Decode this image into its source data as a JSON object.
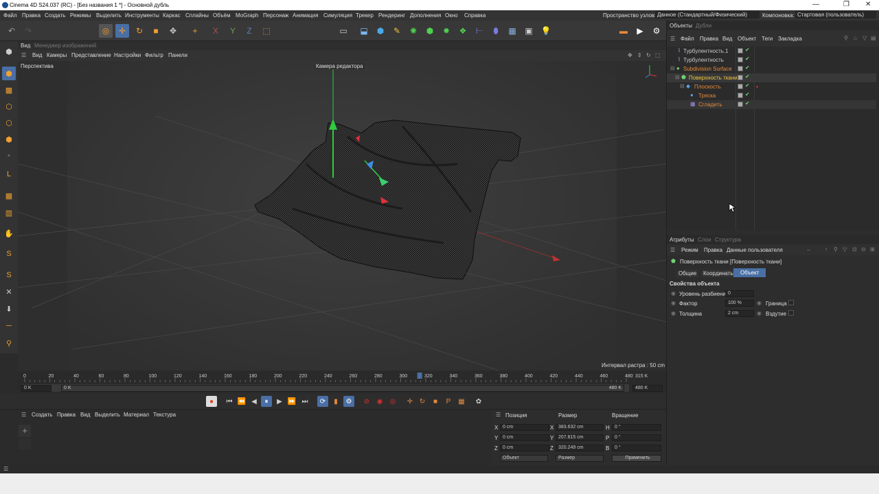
{
  "window": {
    "title": "Cinema 4D S24.037 (RC) - [Без названия 1 *] - Основной дубль",
    "min": "—",
    "max": "❐",
    "close": "✕"
  },
  "menu": [
    "Файл",
    "Правка",
    "Создать",
    "Режимы",
    "Выделить",
    "Инструменты",
    "Каркас",
    "Сплайны",
    "Объём",
    "MoGraph",
    "Персонаж",
    "Анимация",
    "Симуляция",
    "Трекер",
    "Рендеринг",
    "Дополнения",
    "Окно",
    "Справка"
  ],
  "node_space": {
    "label": "Пространство узлов:",
    "value": "Данное (Стандартный/Физический)"
  },
  "layout": {
    "label": "Компоновка:",
    "value": "Стартовая (пользователь)"
  },
  "viewport": {
    "tabs": [
      "Вид",
      "Менеджер изображений"
    ],
    "menu": [
      "Вид",
      "Камеры",
      "Представление",
      "Настройки",
      "Фильтр",
      "Панели"
    ],
    "name": "Перспектива",
    "camera": "Камера редактора",
    "grid_info": "Интервал растра : 50 cm"
  },
  "timeline": {
    "ticks": [
      "0",
      "20",
      "40",
      "60",
      "80",
      "100",
      "120",
      "140",
      "160",
      "180",
      "200",
      "220",
      "240",
      "260",
      "280",
      "300",
      "320",
      "340",
      "360",
      "380",
      "400",
      "420",
      "440",
      "460",
      "480"
    ],
    "current_frame": "315 K",
    "start": "0 K",
    "range_start": "0 K",
    "range_end": "480 K",
    "end": "480 K",
    "playhead_fraction": 0.656
  },
  "material_panel": {
    "menu": [
      "Создать",
      "Правка",
      "Вид",
      "Выделить",
      "Материал",
      "Текстура"
    ]
  },
  "coords": {
    "headers": [
      "Позиция",
      "Размер",
      "Вращение"
    ],
    "rows": [
      {
        "axis": "X",
        "pos": "0 cm",
        "size_axis": "X",
        "size": "383.632 cm",
        "rot_axis": "H",
        "rot": "0 °"
      },
      {
        "axis": "Y",
        "pos": "0 cm",
        "size_axis": "Y",
        "size": "207.815 cm",
        "rot_axis": "P",
        "rot": "0 °"
      },
      {
        "axis": "Z",
        "pos": "0 cm",
        "size_axis": "Z",
        "size": "320.249 cm",
        "rot_axis": "B",
        "rot": "0 °"
      }
    ],
    "mode": "Объект",
    "size_mode": "Размер",
    "apply": "Применить"
  },
  "objects_panel": {
    "tabs": [
      "Объекты",
      "Дубли"
    ],
    "menu": [
      "Файл",
      "Правка",
      "Вид",
      "Объект",
      "Теги",
      "Закладка"
    ],
    "items": [
      {
        "name": "Турбулентность.1",
        "color": "#d0d0d0"
      },
      {
        "name": "Турбулентность",
        "color": "#d0d0d0"
      },
      {
        "name": "Subdivision Surface",
        "color": "#e58a3c"
      },
      {
        "name": "Поверхность ткани",
        "color": "#f0c83c"
      },
      {
        "name": "Плоскость",
        "color": "#e58a3c"
      },
      {
        "name": "Тряска",
        "color": "#e58a3c"
      },
      {
        "name": "Сгладить",
        "color": "#e58a3c"
      }
    ]
  },
  "attributes": {
    "tabs": [
      "Атрибуты",
      "Слои",
      "Структура"
    ],
    "menu": [
      "Режим",
      "Правка",
      "Данные пользователя"
    ],
    "object_title": "Поверхность ткани [Поверхность ткани]",
    "subtabs": [
      "Общие",
      "Координаты",
      "Объект"
    ],
    "section": "Свойства объекта",
    "props": [
      {
        "label": "Уровень разбиения",
        "value": "0"
      },
      {
        "label": "Фактор",
        "value": "100 %",
        "extra": "Граница"
      },
      {
        "label": "Толщина",
        "value": "2 cm",
        "extra": "Вздутие"
      }
    ]
  },
  "colors": {
    "accent": "#4a6fa5",
    "orange": "#e58a3c",
    "green_axis": "#2ecc40",
    "red_axis": "#e0303c",
    "blue_axis": "#3a8fe0"
  }
}
